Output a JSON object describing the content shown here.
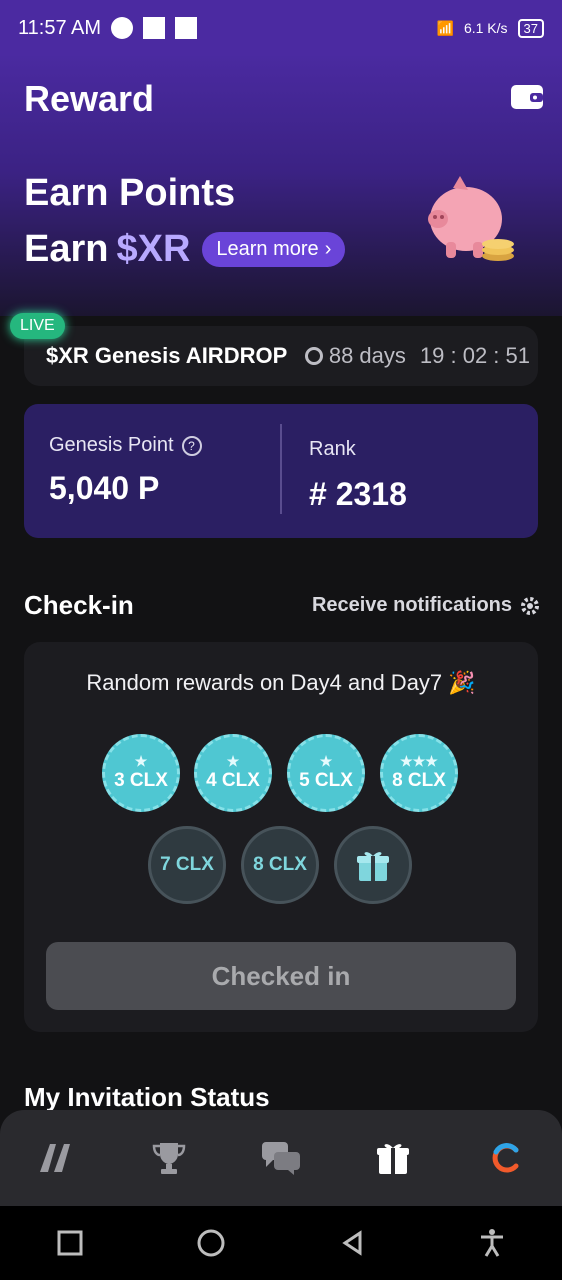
{
  "status_bar": {
    "time": "11:57 AM",
    "net_speed": "6.1 K/s",
    "battery": "37"
  },
  "header": {
    "title": "Reward"
  },
  "hero": {
    "line1": "Earn Points",
    "line2_prefix": "Earn",
    "line2_token": "$XR",
    "learn_more_label": "Learn more",
    "learn_more_chevron": "›"
  },
  "airdrop": {
    "badge": "LIVE",
    "title": "$XR Genesis AIRDROP",
    "days": "88 days",
    "timer": "19 : 02 : 51"
  },
  "genesis": {
    "point_label": "Genesis Point",
    "point_help": "?",
    "point_value": "5,040 P",
    "rank_label": "Rank",
    "rank_value": "# 2318"
  },
  "checkin": {
    "title": "Check-in",
    "notify_label": "Receive notifications",
    "random_text": "Random rewards on Day4 and Day7 🎉",
    "days": [
      {
        "label": "3 CLX",
        "status": "checked",
        "stars": "★"
      },
      {
        "label": "4 CLX",
        "status": "checked",
        "stars": "★"
      },
      {
        "label": "5 CLX",
        "status": "checked",
        "stars": "★"
      },
      {
        "label": "8 CLX",
        "status": "checked",
        "stars": "★★★"
      },
      {
        "label": "7 CLX",
        "status": "pending",
        "stars": ""
      },
      {
        "label": "8 CLX",
        "status": "pending",
        "stars": ""
      },
      {
        "label": "",
        "status": "pending",
        "icon": "gift-icon"
      }
    ],
    "button_label": "Checked in"
  },
  "invitation": {
    "title": "My Invitation Status"
  },
  "bottom_nav": {
    "items": [
      {
        "name": "home-logo-icon"
      },
      {
        "name": "trophy-icon"
      },
      {
        "name": "chat-icon"
      },
      {
        "name": "gift-icon"
      },
      {
        "name": "c-logo-icon"
      }
    ]
  },
  "colors": {
    "accent": "#6a44d8",
    "header_bg": "#4b2aa1",
    "coin": "#4fc7d2",
    "live": "#25b77e"
  }
}
